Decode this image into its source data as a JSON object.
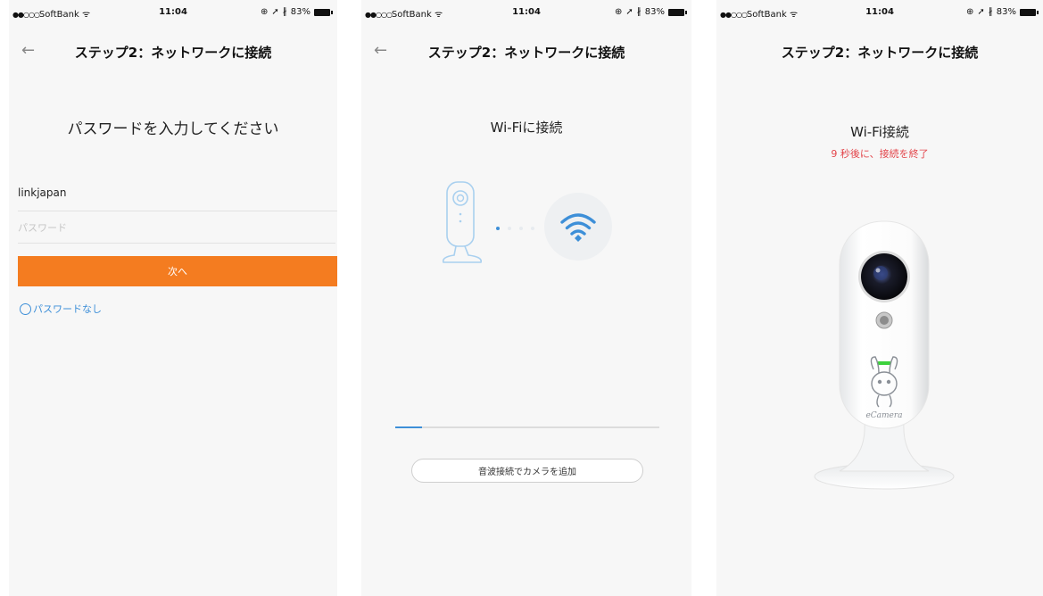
{
  "status_bar": {
    "carrier": "SoftBank",
    "time": "11:04",
    "battery": "83%"
  },
  "nav": {
    "title": "ステップ2：ネットワークに接続",
    "back_icon": "arrow-left-icon"
  },
  "screen1": {
    "heading": "パスワードを入力してください",
    "ssid": "linkjapan",
    "password_placeholder": "パスワード",
    "next_button": "次へ",
    "no_password_label": "パスワードなし"
  },
  "screen2": {
    "heading": "Wi-Fiに接続",
    "progress_fraction": 0.1,
    "sonic_button": "音波接続でカメラを追加"
  },
  "screen3": {
    "heading": "Wi-Fi接続",
    "countdown": "9 秒後に、接続を終了",
    "camera_brand": "eCamera"
  },
  "colors": {
    "accent": "#f47c20",
    "link_blue": "#3d8fd8",
    "countdown_red": "#e3464b",
    "background": "#f7f7f7"
  }
}
